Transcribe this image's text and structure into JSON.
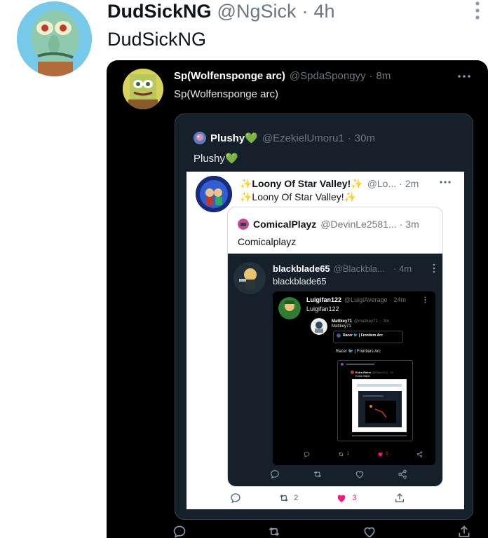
{
  "top": {
    "name": "DudSickNG",
    "handle": "@NgSick",
    "time": "4h",
    "text": "DudSickNG"
  },
  "q1": {
    "name": "Sp(Wolfensponge arc)",
    "handle": "@SpdaSpongyy",
    "time": "8m",
    "text": "Sp(Wolfensponge arc)"
  },
  "q2": {
    "name": "Plushy💚",
    "handle": "@EzekielUmoru1",
    "time": "30m",
    "text": "Plushy💚"
  },
  "q3": {
    "name": "✨Loony Of Star Valley!✨",
    "handle": "@Lo...",
    "time": "2m",
    "text": "✨Loony Of Star Valley!✨",
    "actions": {
      "retweets": "2",
      "likes": "3"
    }
  },
  "q4": {
    "name": "ComicalPlayz",
    "handle": "@DevinLe2581...",
    "time": "3m",
    "text": "Comicalplayz"
  },
  "q5": {
    "name": "blackblade65",
    "handle": "@Blackbla...",
    "time": "4m",
    "text": "blackblade65"
  },
  "q6": {
    "name": "Luigifan122",
    "handle": "@LuigiAverage",
    "time": "24m",
    "text": "Luigifan122",
    "actions": {
      "retweets": "1",
      "likes": "5"
    }
  },
  "q7": {
    "name": "Mattkey71",
    "handle": "@mattkey71",
    "time": "3m",
    "text": "Mattkey71"
  },
  "q8": {
    "name": "Racer",
    "text": "Racer 🐦 | Frontiers Arc",
    "inner_name": "Racer 🐦 | Frontiers Arc"
  },
  "q9": {
    "name": "Extra Raker",
    "handle": "@Raker1Cy",
    "time": "2h",
    "text": "Extra Raker"
  }
}
